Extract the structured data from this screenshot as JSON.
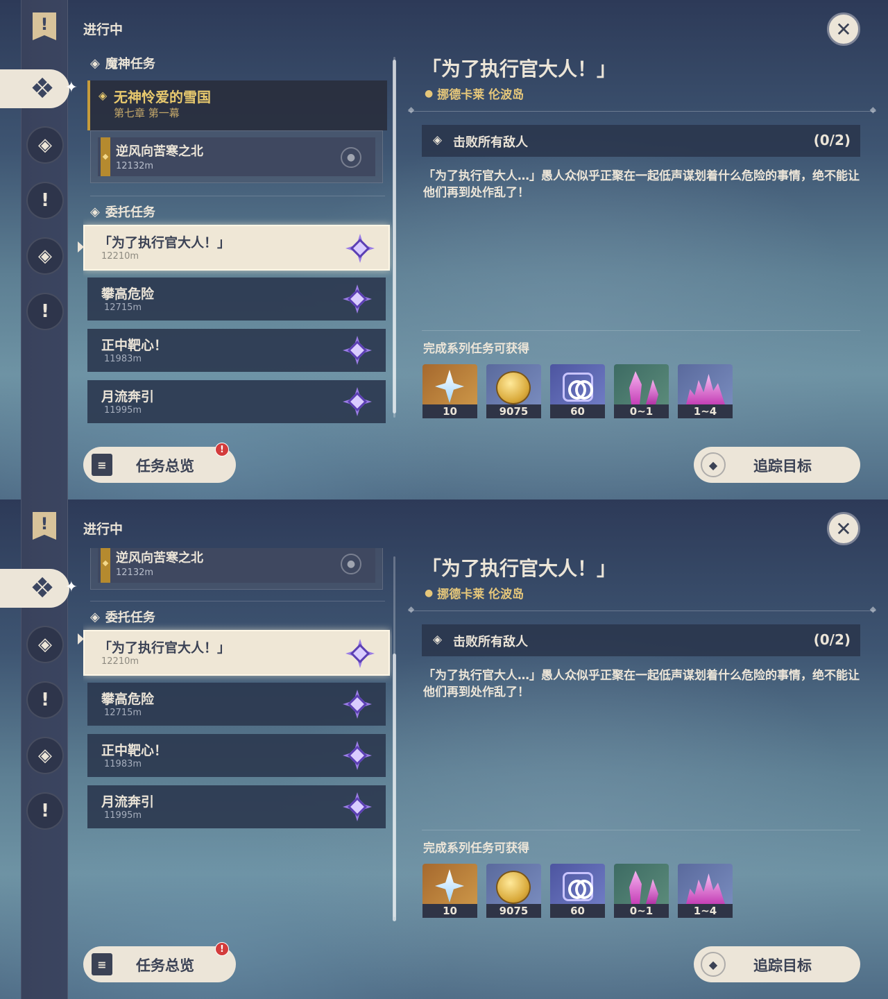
{
  "section_heading": "进行中",
  "categories": {
    "archon": "魔神任务",
    "daily": "委托任务"
  },
  "archon_quest": {
    "title": "无神怜爱的雪国",
    "subtitle": "第七章 第一幕"
  },
  "sub_quest": {
    "title": "逆风向苦寒之北",
    "distance": "12132m"
  },
  "daily_quests": [
    {
      "title": "「为了执行官大人！」",
      "distance": "12210m",
      "selected": true
    },
    {
      "title": "攀高危险",
      "distance": "12715m",
      "selected": false
    },
    {
      "title": "正中靶心！",
      "distance": "11983m",
      "selected": false
    },
    {
      "title": "月流奔引",
      "distance": "11995m",
      "selected": false
    }
  ],
  "detail": {
    "title": "「为了执行官大人！」",
    "location": "挪德卡莱 伦波岛",
    "objective": "击败所有敌人",
    "progress": "(0/2)",
    "description": "「为了执行官大人…」愚人众似乎正聚在一起低声谋划着什么危险的事情，绝不能让他们再到处作乱了！",
    "rewards_title": "完成系列任务可获得",
    "rewards": [
      {
        "icon": "primogem-icon",
        "count": "10"
      },
      {
        "icon": "mora-icon",
        "count": "9075"
      },
      {
        "icon": "fellowship-icon",
        "count": "60"
      },
      {
        "icon": "crystal-chunk-icon",
        "count": "0~1"
      },
      {
        "icon": "crystal-cluster-icon",
        "count": "1~4"
      }
    ]
  },
  "buttons": {
    "overview": "任务总览",
    "overview_badge": "!",
    "track": "追踪目标"
  },
  "colors": {
    "accent_cream": "#ece5d8",
    "archon_gold": "#e8c96e",
    "location_gold": "#e6c77a",
    "daily_purple": "#9a7ce6"
  }
}
